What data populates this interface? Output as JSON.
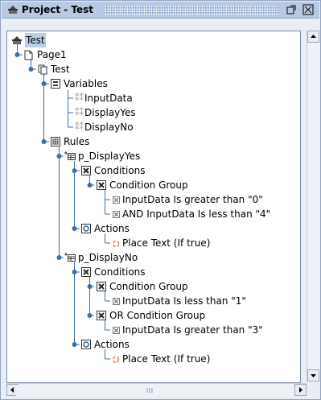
{
  "window": {
    "title": "Project - Test"
  },
  "tree": {
    "root": "Test",
    "page": "Page1",
    "test": "Test",
    "variables": "Variables",
    "var_input": "InputData",
    "var_yes": "DisplayYes",
    "var_no": "DisplayNo",
    "rules": "Rules",
    "rule1": "p_DisplayYes",
    "rule1_conditions": "Conditions",
    "rule1_group": "Condition Group",
    "rule1_cond1": "InputData Is greater than \"0\"",
    "rule1_cond2": "AND InputData Is less than \"4\"",
    "rule1_actions": "Actions",
    "rule1_action1": "Place Text (If true)",
    "rule2": "p_DisplayNo",
    "rule2_conditions": "Conditions",
    "rule2_group1": "Condition Group",
    "rule2_cond1": "InputData Is less than \"1\"",
    "rule2_group2": "OR Condition Group",
    "rule2_cond2": "InputData Is greater than \"3\"",
    "rule2_actions": "Actions",
    "rule2_action1": "Place Text (If true)"
  },
  "colors": {
    "titlebar": "#b8c9e3",
    "selection": "#b8cfe5",
    "tree_line": "#3c6ea6",
    "action_icon": "#e07050"
  }
}
